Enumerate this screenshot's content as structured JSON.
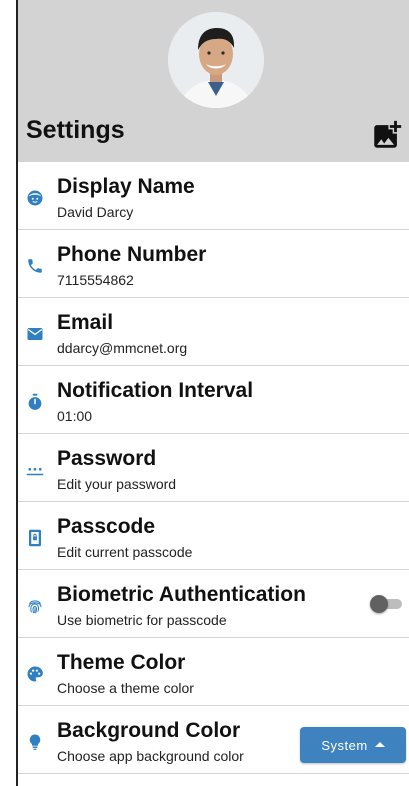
{
  "header": {
    "title": "Settings",
    "avatar_icon": "user-avatar",
    "add_photo_icon": "add-photo-icon"
  },
  "settings": [
    {
      "label": "Display Name",
      "value": "David Darcy",
      "icon": "face-icon"
    },
    {
      "label": "Phone Number",
      "value": "7115554862",
      "icon": "phone-icon"
    },
    {
      "label": "Email",
      "value": "ddarcy@mmcnet.org",
      "icon": "email-icon"
    },
    {
      "label": "Notification Interval",
      "value": "01:00",
      "icon": "timer-icon"
    },
    {
      "label": "Password",
      "value": "Edit your password",
      "icon": "password-icon"
    },
    {
      "label": "Passcode",
      "value": "Edit current passcode",
      "icon": "passcode-icon"
    },
    {
      "label": "Biometric Authentication",
      "value": "Use biometric for passcode",
      "icon": "fingerprint-icon",
      "toggle_on": false
    },
    {
      "label": "Theme Color",
      "value": "Choose a theme color",
      "icon": "palette-icon"
    },
    {
      "label": "Background Color",
      "value": "Choose app background color",
      "icon": "lightbulb-icon",
      "dropdown_value": "System"
    }
  ],
  "colors": {
    "accent": "#2f7fc1",
    "header_bg": "#d3d3d3",
    "button_bg": "#3f82c0"
  }
}
